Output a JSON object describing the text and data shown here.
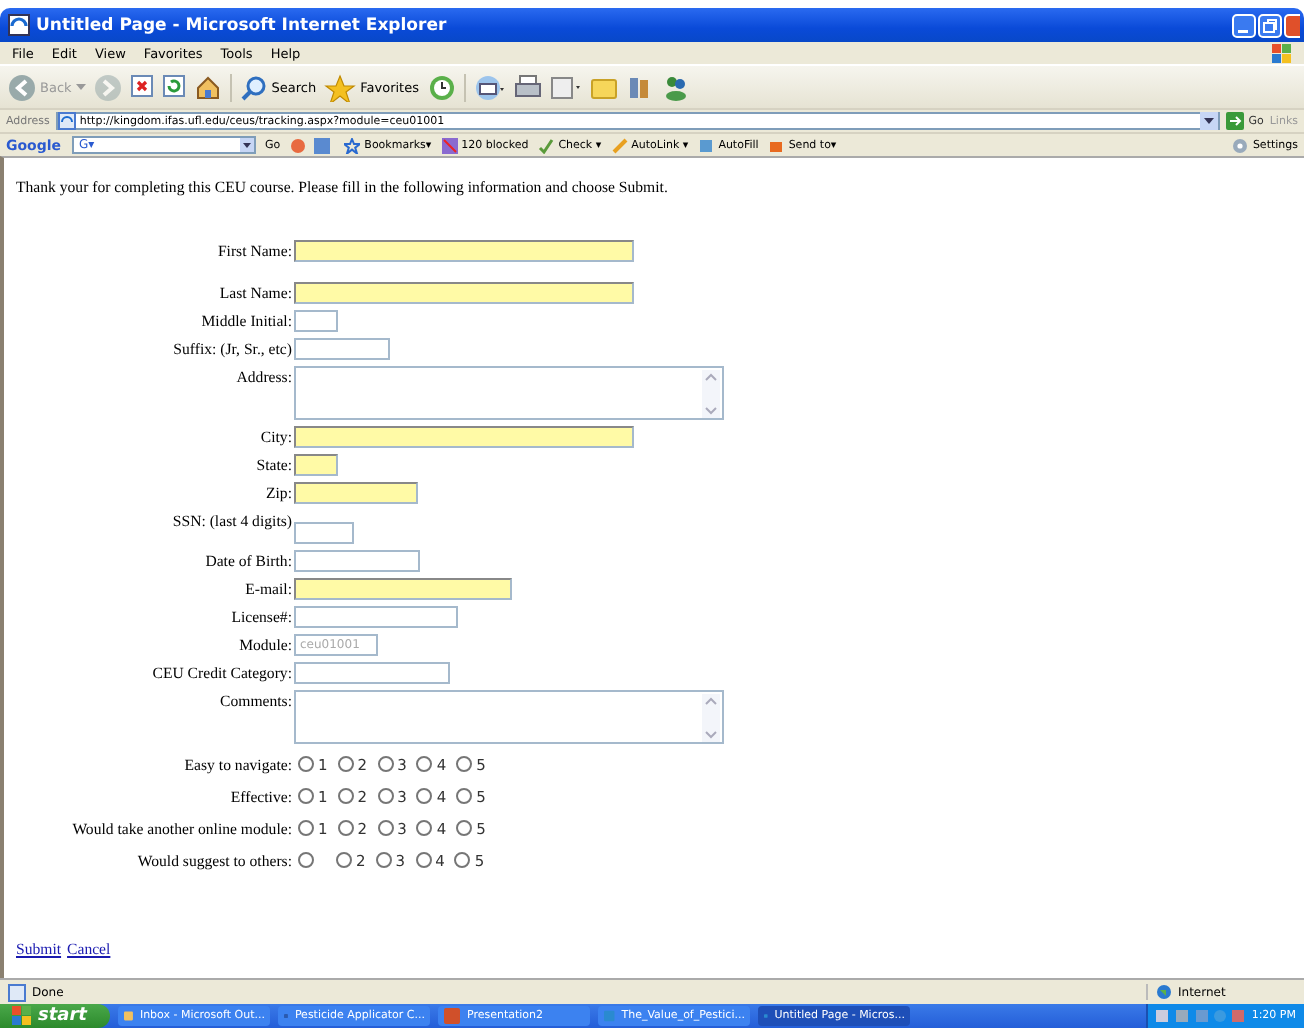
{
  "window": {
    "title": "Untitled Page - Microsoft Internet Explorer"
  },
  "menu": [
    "File",
    "Edit",
    "View",
    "Favorites",
    "Tools",
    "Help"
  ],
  "toolbar": [
    {
      "kind": "back",
      "label": "Back",
      "disabled": true
    },
    {
      "kind": "forward",
      "disabled": true
    },
    {
      "kind": "stop"
    },
    {
      "kind": "refresh"
    },
    {
      "kind": "home"
    },
    {
      "kind": "search",
      "label": "Search"
    },
    {
      "kind": "favorites",
      "label": "Favorites"
    },
    {
      "kind": "history"
    },
    {
      "kind": "mail"
    },
    {
      "kind": "print"
    },
    {
      "kind": "edit"
    },
    {
      "kind": "folder"
    },
    {
      "kind": "research"
    },
    {
      "kind": "messenger"
    }
  ],
  "address": {
    "label": "Address",
    "url": "http://kingdom.ifas.ufl.edu/ceus/tracking.aspx?module=ceu01001",
    "go": "Go",
    "links": "Links"
  },
  "google_bar": {
    "logo": "Google",
    "search_label": "G▾",
    "items": [
      {
        "kind": "go",
        "label": "Go"
      },
      {
        "kind": "bookmarks",
        "label": "Bookmarks▾"
      },
      {
        "kind": "blocked",
        "label": "120 blocked"
      },
      {
        "kind": "check",
        "label": "Check ▾"
      },
      {
        "kind": "autolink",
        "label": "AutoLink ▾"
      },
      {
        "kind": "autofill",
        "label": "AutoFill"
      },
      {
        "kind": "sendto",
        "label": "Send to▾"
      }
    ],
    "settings": "Settings"
  },
  "intro": "Thank your for completing this CEU course. Please fill in the following information and choose Submit.",
  "fields": [
    {
      "label": "First Name:",
      "kind": "text",
      "required": true
    },
    {
      "label": "Last Name:",
      "kind": "text",
      "required": true
    },
    {
      "label": "Middle Initial:",
      "kind": "text",
      "required": false
    },
    {
      "label": "Suffix: (Jr, Sr., etc)",
      "kind": "text",
      "required": false
    },
    {
      "label": "Address:",
      "kind": "textarea",
      "required": false
    },
    {
      "label": "City:",
      "kind": "text",
      "required": true
    },
    {
      "label": "State:",
      "kind": "text",
      "required": true
    },
    {
      "label": "Zip:",
      "kind": "text",
      "required": true
    },
    {
      "label": "SSN: (last 4 digits)",
      "kind": "text",
      "required": false
    },
    {
      "label": "Date of Birth:",
      "kind": "text",
      "required": false
    },
    {
      "label": "E-mail:",
      "kind": "text",
      "required": true
    },
    {
      "label": "License#:",
      "kind": "text",
      "required": false
    },
    {
      "label": "Module:",
      "kind": "text",
      "required": false,
      "disabled": true,
      "value": "ceu01001"
    },
    {
      "label": "CEU Credit Category:",
      "kind": "text",
      "required": false
    },
    {
      "label": "Comments:",
      "kind": "textarea",
      "required": false
    }
  ],
  "ratings": [
    {
      "label": "Easy to navigate:",
      "options": [
        {
          "label": "1",
          "selected": false
        },
        {
          "label": "2",
          "selected": false
        },
        {
          "label": "3",
          "selected": false
        },
        {
          "label": "4",
          "selected": false
        },
        {
          "label": "5",
          "selected": false
        }
      ]
    },
    {
      "label": "Effective:",
      "options": [
        {
          "label": "1",
          "selected": false
        },
        {
          "label": "2",
          "selected": false
        },
        {
          "label": "3",
          "selected": false
        },
        {
          "label": "4",
          "selected": false
        },
        {
          "label": "5",
          "selected": false
        }
      ]
    },
    {
      "label": "Would take another online module:",
      "options": [
        {
          "label": "1",
          "selected": false
        },
        {
          "label": "2",
          "selected": false
        },
        {
          "label": "3",
          "selected": false
        },
        {
          "label": "4",
          "selected": false
        },
        {
          "label": "5",
          "selected": false
        }
      ]
    },
    {
      "label": "Would suggest to others:",
      "options": [
        {
          "selected": false
        },
        {
          "label": "2",
          "selected": false
        },
        {
          "label": "3",
          "selected": false
        },
        {
          "label": "4",
          "selected": false
        },
        {
          "label": "5",
          "selected": false
        }
      ]
    }
  ],
  "links": [
    "Submit",
    "Cancel"
  ],
  "status_bar": {
    "text": "Done",
    "zone": "Internet"
  },
  "taskbar": {
    "start": "start",
    "tasks": [
      {
        "kind": "outlook",
        "label": "Inbox - Microsoft Out...",
        "selected": false
      },
      {
        "kind": "word",
        "label": "Pesticide Applicator C...",
        "selected": false
      },
      {
        "kind": "powerpoint",
        "label": "Presentation2",
        "selected": false
      },
      {
        "kind": "ie",
        "label": "The_Value_of_Pestici...",
        "selected": false
      },
      {
        "kind": "ie",
        "label": "Untitled Page - Micros...",
        "selected": true
      }
    ],
    "clock": "1:20 PM"
  }
}
